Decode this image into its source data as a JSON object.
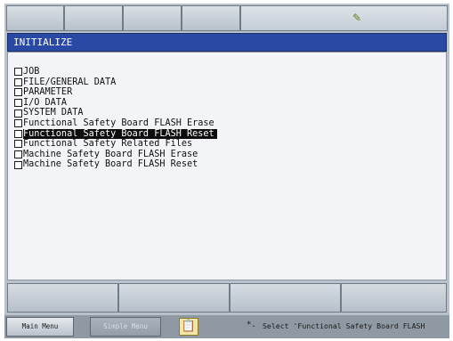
{
  "title": "INITIALIZE",
  "items": [
    {
      "label": "JOB"
    },
    {
      "label": "FILE/GENERAL DATA"
    },
    {
      "label": "PARAMETER"
    },
    {
      "label": "I/O DATA"
    },
    {
      "label": "SYSTEM DATA"
    },
    {
      "label": "Functional Safety Board FLASH Erase"
    },
    {
      "label": "Functional Safety Board FLASH Reset",
      "selected": true
    },
    {
      "label": "Functional Safety Related Files"
    },
    {
      "label": "Machine Safety Board FLASH Erase"
    },
    {
      "label": "Machine Safety Board FLASH Reset"
    }
  ],
  "status": {
    "main_menu": "Main Menu",
    "simple_menu": "Simple Menu",
    "dot": "*.",
    "message": "Select 'Functional Safety Board FLASH"
  },
  "icons": {
    "tab_icon": "tool-icon",
    "clipboard": "clipboard-icon"
  },
  "colors": {
    "title_bar": "#2a49a4",
    "selection": "#0d0d0d",
    "panel": "#b9c2cb"
  }
}
